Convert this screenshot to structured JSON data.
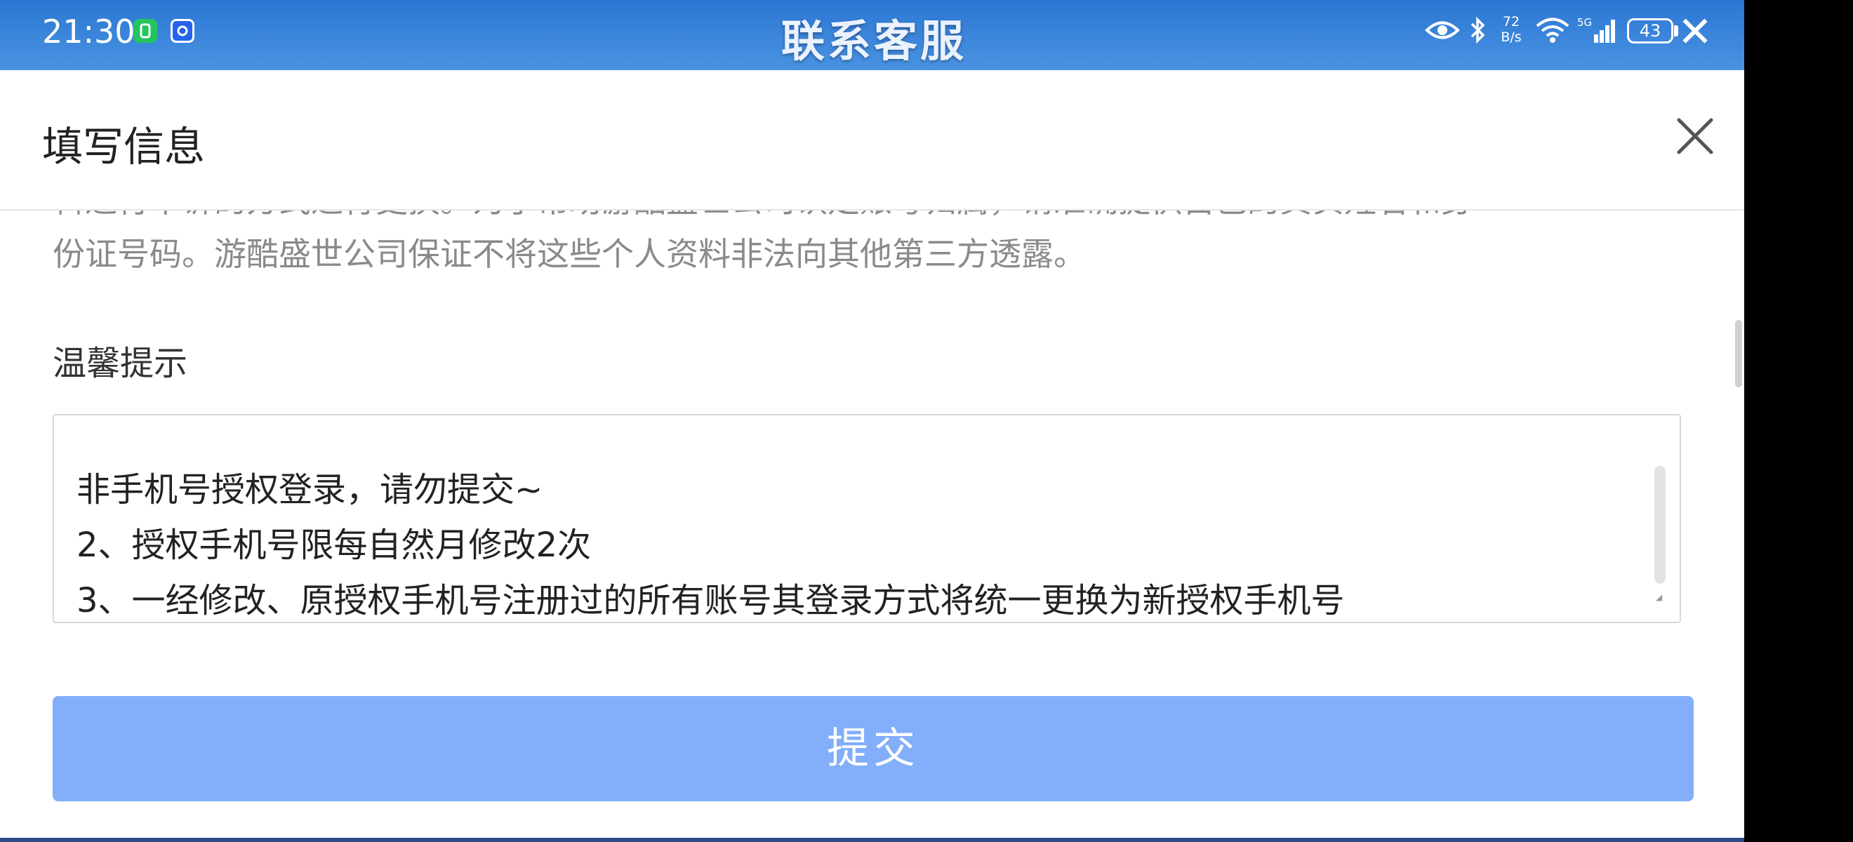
{
  "status_bar": {
    "time": "21:30",
    "network_speed_value": "72",
    "network_speed_unit": "B/s",
    "signal_label": "5G",
    "battery": "43",
    "icons": [
      "notification-app-icon",
      "notification-app-icon-2",
      "eye-icon",
      "bluetooth-icon",
      "wifi-icon",
      "signal-icon",
      "battery-icon",
      "close-icon"
    ]
  },
  "page_header": {
    "title": "联系客服"
  },
  "sheet": {
    "title": "填写信息",
    "notice_line_1": "料进行申诉的方式进行更换。为了帮助游酷盛世公司认定账号归属，请准确提供自己的真实姓名和身",
    "notice_line_2": "份证号码。游酷盛世公司保证不将这些个人资料非法向其他第三方透露。",
    "tips_heading": "温馨提示",
    "tips_lines": [
      "非手机号授权登录，请勿提交~",
      "2、授权手机号限每自然月修改2次",
      "3、一经修改、原授权手机号注册过的所有账号其登录方式将统一更换为新授权手机号"
    ],
    "submit_label": "提交"
  },
  "colors": {
    "header_blue": "#2f7ed8",
    "submit_button": "#82aefa",
    "muted_text": "#8a8a8a"
  }
}
